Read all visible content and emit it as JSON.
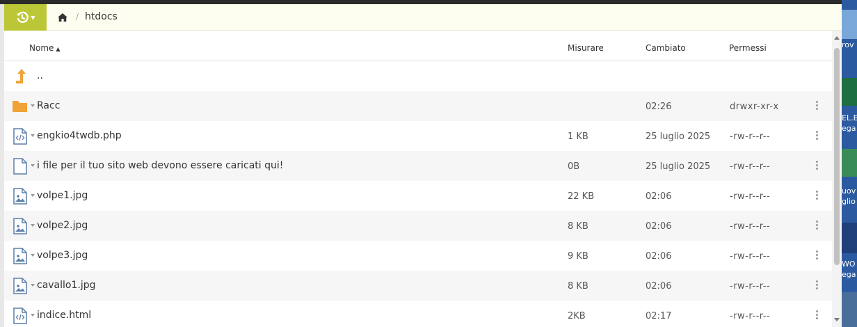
{
  "toolbar": {
    "action_icon": "history-icon",
    "home_icon": "home-icon",
    "separator": "/",
    "current_folder": "htdocs"
  },
  "columns": {
    "name": "Nome",
    "size": "Misurare",
    "modified": "Cambiato",
    "permissions": "Permessi"
  },
  "colors": {
    "accent": "#bcc737",
    "folder": "#f0a338",
    "file_icon": "#5b7fa8"
  },
  "rows": [
    {
      "name": "..",
      "icon": "parent-directory-icon",
      "size": "",
      "date": "",
      "perm": ""
    },
    {
      "name": "Racc",
      "icon": "folder-icon",
      "size": "",
      "date": "02:26",
      "perm": "drwxr-xr-x"
    },
    {
      "name": "engkio4twdb.php",
      "icon": "code-file-icon",
      "size": "1 KB",
      "date": "25 luglio 2025",
      "perm": "-rw-r--r--"
    },
    {
      "name": "i file per il tuo sito web devono essere caricati qui!",
      "icon": "file-icon",
      "size": "0B",
      "date": "25 luglio 2025",
      "perm": "-rw-r--r--"
    },
    {
      "name": "volpe1.jpg",
      "icon": "image-file-icon",
      "size": "22 KB",
      "date": "02:06",
      "perm": "-rw-r--r--"
    },
    {
      "name": "volpe2.jpg",
      "icon": "image-file-icon",
      "size": "8 KB",
      "date": "02:06",
      "perm": "-rw-r--r--"
    },
    {
      "name": "volpe3.jpg",
      "icon": "image-file-icon",
      "size": "9 KB",
      "date": "02:06",
      "perm": "-rw-r--r--"
    },
    {
      "name": "cavallo1.jpg",
      "icon": "image-file-icon",
      "size": "8 KB",
      "date": "02:06",
      "perm": "-rw-r--r--"
    },
    {
      "name": "indice.html",
      "icon": "code-file-icon",
      "size": "2KB",
      "date": "02:17",
      "perm": "-rw-r--r--"
    }
  ],
  "desktop": {
    "frag1": "rov",
    "frag2": "EL.E",
    "frag3": "ega",
    "frag4": "uov",
    "frag5": "glio",
    "frag6": "WO",
    "frag7": "ega"
  }
}
